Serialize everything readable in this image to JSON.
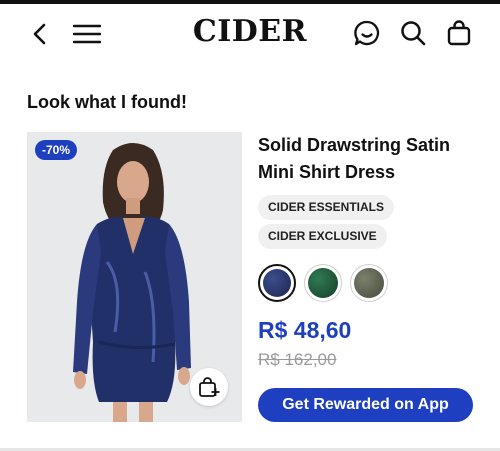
{
  "header": {
    "logo": "CIDER",
    "icons": [
      "back-arrow-icon",
      "menu-icon",
      "chat-icon",
      "search-icon",
      "shopping-bag-icon"
    ]
  },
  "section": {
    "title": "Look what I found!"
  },
  "product": {
    "discount_badge": "-70%",
    "title": "Solid Drawstring Satin Mini Shirt Dress",
    "tags": [
      "CIDER ESSENTIALS",
      "CIDER EXCLUSIVE"
    ],
    "swatches": [
      {
        "name": "navy",
        "color": "#24305e",
        "selected": true
      },
      {
        "name": "green",
        "color": "#1f5a3c",
        "selected": false
      },
      {
        "name": "olive-grey",
        "color": "#5f6352",
        "selected": false
      }
    ],
    "price": "R$ 48,60",
    "original_price": "R$ 162,00",
    "cta_label": "Get Rewarded on App"
  },
  "colors": {
    "accent": "#1e3fbf",
    "text": "#111111",
    "muted": "#9a9a9a",
    "tag_bg": "#f0f0f0"
  }
}
